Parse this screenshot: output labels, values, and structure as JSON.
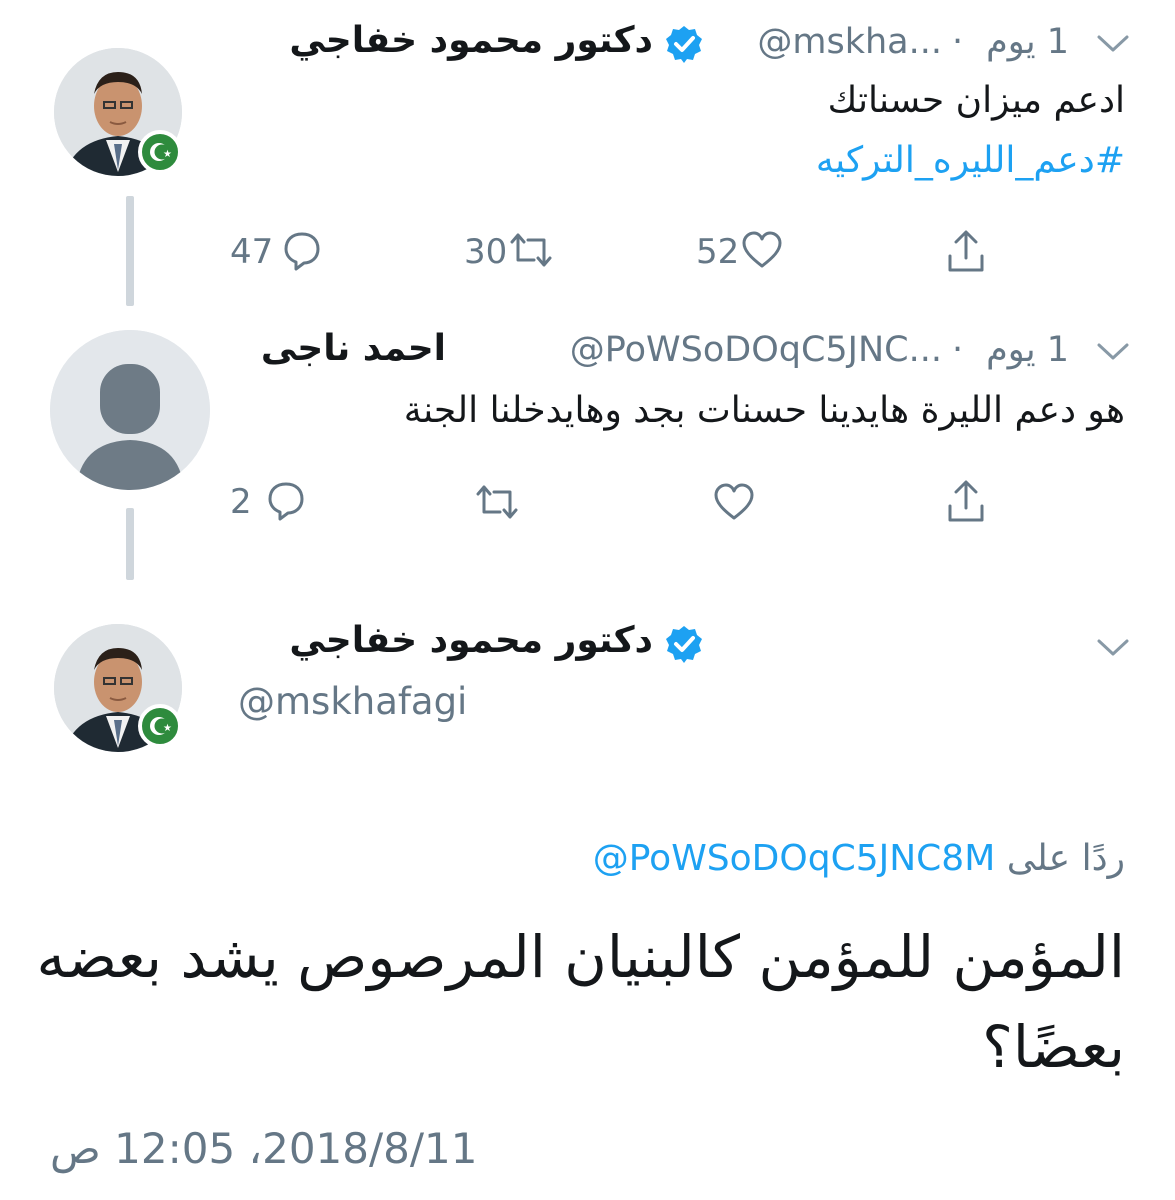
{
  "tweet1": {
    "display_name": "دكتور محمود خفاجي",
    "handle": "@mskha...",
    "time": "1 يوم",
    "text": "ادعم ميزان حسناتك",
    "hashtag": "#دعم_الليره_التركيه",
    "counts": {
      "replies": "47",
      "retweets": "30",
      "likes": "52"
    }
  },
  "tweet2": {
    "display_name": "احمد ناجى",
    "handle": "@PoWSoDOqC5JNC...",
    "time": "1 يوم",
    "text": "هو دعم الليرة هايدينا حسنات بجد وهايدخلنا الجنة",
    "counts": {
      "replies": "2"
    }
  },
  "main_tweet": {
    "display_name": "دكتور محمود خفاجي",
    "handle": "@mskhafagi",
    "reply_prefix": "ردًا على",
    "reply_handle": "@PoWSoDOqC5JNC8M",
    "line1": "المؤمن للمؤمن كالبنيان المرصوص يشد بعضه",
    "line2": "بعضًا؟",
    "timestamp": "2018/8/11، 12:05 ص"
  },
  "icons": {
    "verified": "verified-badge-icon",
    "reply": "reply-bubble-icon",
    "retweet": "retweet-icon",
    "like": "heart-icon",
    "share": "share-icon",
    "more": "chevron-down-icon"
  },
  "colors": {
    "link": "#1da1f2",
    "muted": "#657786",
    "verified": "#1da1f2",
    "badge": "#2e8b3d"
  }
}
